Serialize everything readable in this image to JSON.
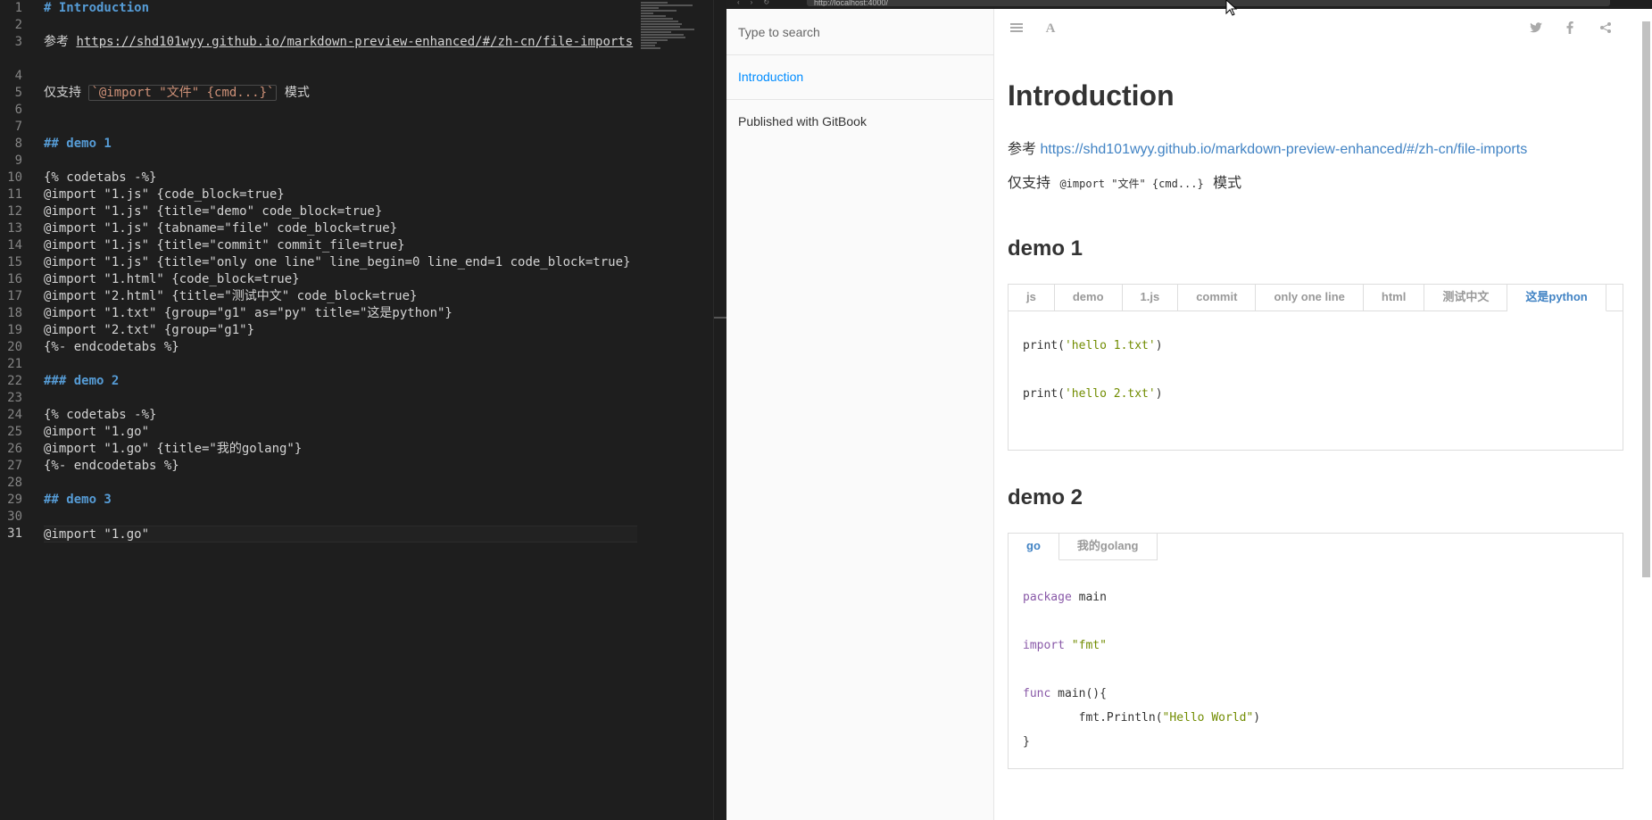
{
  "editor": {
    "line_numbers": [
      "1",
      "2",
      "3",
      "",
      "4",
      "5",
      "6",
      "7",
      "8",
      "9",
      "10",
      "11",
      "12",
      "13",
      "14",
      "15",
      "16",
      "17",
      "18",
      "19",
      "20",
      "21",
      "22",
      "23",
      "24",
      "25",
      "26",
      "27",
      "28",
      "29",
      "30",
      "31"
    ],
    "lines": {
      "l1": "# Introduction",
      "l3_prefix": "参考 ",
      "l3_link": "https://shd101wyy.github.io/markdown-preview-enhanced/#/zh-cn/file-imports",
      "l5_prefix": "仅支持 ",
      "l5_code": "`@import \"文件\" {cmd...}`",
      "l5_suffix": " 模式",
      "l8": "## demo 1",
      "l10": "{% codetabs -%}",
      "l11": "@import \"1.js\" {code_block=true}",
      "l12": "@import \"1.js\" {title=\"demo\" code_block=true}",
      "l13": "@import \"1.js\" {tabname=\"file\" code_block=true}",
      "l14": "@import \"1.js\" {title=\"commit\" commit_file=true}",
      "l15": "@import \"1.js\" {title=\"only one line\" line_begin=0 line_end=1 code_block=true}",
      "l16": "@import \"1.html\" {code_block=true}",
      "l17": "@import \"2.html\" {title=\"测试中文\" code_block=true}",
      "l18": "@import \"1.txt\" {group=\"g1\" as=\"py\" title=\"这是python\"}",
      "l19": "@import \"2.txt\" {group=\"g1\"}",
      "l20": "{%- endcodetabs %}",
      "l22": "### demo 2",
      "l24": "{% codetabs -%}",
      "l25": "@import \"1.go\"",
      "l26": "@import \"1.go\" {title=\"我的golang\"}",
      "l27": "{%- endcodetabs %}",
      "l29": "## demo 3",
      "l31": "@import \"1.go\""
    }
  },
  "browser": {
    "url": "http://localhost:4000/"
  },
  "summary": {
    "search_placeholder": "Type to search",
    "items": [
      {
        "label": "Introduction",
        "active": true
      },
      {
        "label": "Published with GitBook",
        "active": false
      }
    ]
  },
  "header_icons": [
    "menu-icon",
    "font-icon",
    "twitter-icon",
    "facebook-icon",
    "share-icon"
  ],
  "page": {
    "title": "Introduction",
    "ref_prefix": "参考 ",
    "ref_link": "https://shd101wyy.github.io/markdown-preview-enhanced/#/zh-cn/file-imports",
    "only_prefix": "仅支持 ",
    "only_code": "@import \"文件\" {cmd...}",
    "only_suffix": " 模式",
    "demo1": {
      "title": "demo 1",
      "tabs": [
        "js",
        "demo",
        "1.js",
        "commit",
        "only one line",
        "html",
        "测试中文",
        "这是python"
      ],
      "active_tab": "这是python",
      "code": {
        "line1_fn": "print(",
        "line1_str": "'hello 1.txt'",
        "line1_end": ")",
        "line2_fn": "print(",
        "line2_str": "'hello 2.txt'",
        "line2_end": ")"
      }
    },
    "demo2": {
      "title": "demo 2",
      "tabs": [
        "go",
        "我的golang"
      ],
      "active_tab": "go",
      "code": {
        "pkg_kw": "package",
        "pkg_name": " main",
        "imp_kw": "import",
        "imp_str": " \"fmt\"",
        "func_kw": "func",
        "func_sig": " main(){",
        "println_pre": "        fmt.Println(",
        "println_str": "\"Hello World\"",
        "println_end": ")",
        "close": "}"
      }
    }
  },
  "colors": {
    "editor_bg": "#1e1e1e",
    "heading": "#569cd6",
    "link": "#4183c4",
    "active_nav": "#008cff",
    "string": "#718c00",
    "keyword": "#8959a8"
  }
}
